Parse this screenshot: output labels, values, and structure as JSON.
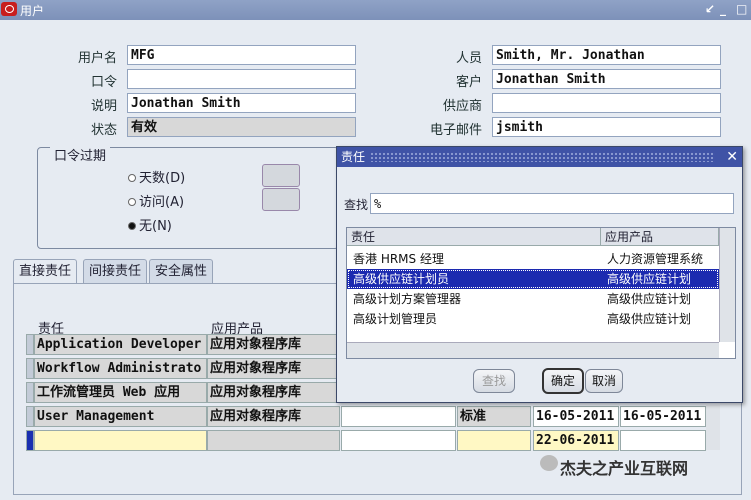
{
  "window": {
    "title": "用户",
    "controls": [
      "↙",
      "_",
      "□"
    ]
  },
  "form": {
    "username_label": "用户名",
    "username": "MFG",
    "password_label": "口令",
    "password": "",
    "description_label": "说明",
    "description": "Jonathan Smith",
    "status_label": "状态",
    "status": "有效",
    "person_label": "人员",
    "person": "Smith, Mr. Jonathan",
    "customer_label": "客户",
    "customer": "Jonathan Smith",
    "supplier_label": "供应商",
    "supplier": "",
    "email_label": "电子邮件",
    "email": "jsmith"
  },
  "password_expiry": {
    "title": "口令过期",
    "options": [
      "天数(D)",
      "访问(A)",
      "无(N)"
    ],
    "selected": "无(N)"
  },
  "tabs": [
    "直接责任",
    "间接责任",
    "安全属性"
  ],
  "grid": {
    "headers": [
      "责任",
      "应用产品"
    ],
    "rows": [
      {
        "resp": "Application Developer",
        "app": "应用对象程序库"
      },
      {
        "resp": "Workflow Administrato",
        "app": "应用对象程序库"
      },
      {
        "resp": "工作流管理员 Web 应用",
        "app": "应用对象程序库"
      },
      {
        "resp": "User Management",
        "app": "应用对象程序库",
        "group": "标准",
        "from": "16-05-2011",
        "to": "16-05-2011"
      },
      {
        "resp": "",
        "app": "",
        "group": "",
        "from": "22-06-2011",
        "to": ""
      }
    ]
  },
  "dialog": {
    "title": "责任",
    "find_label": "查找",
    "find_value": "%",
    "headers": [
      "责任",
      "应用产品"
    ],
    "rows": [
      {
        "resp": "香港 HRMS 经理",
        "app": "人力资源管理系统"
      },
      {
        "resp": "高级供应链计划员",
        "app": "高级供应链计划"
      },
      {
        "resp": "高级计划方案管理器",
        "app": "高级供应链计划"
      },
      {
        "resp": "高级计划管理员",
        "app": "高级供应链计划"
      }
    ],
    "selected_index": 1,
    "buttons": {
      "find": "查找",
      "ok": "确定",
      "cancel": "取消"
    }
  },
  "watermark": "杰夫之产业互联网"
}
